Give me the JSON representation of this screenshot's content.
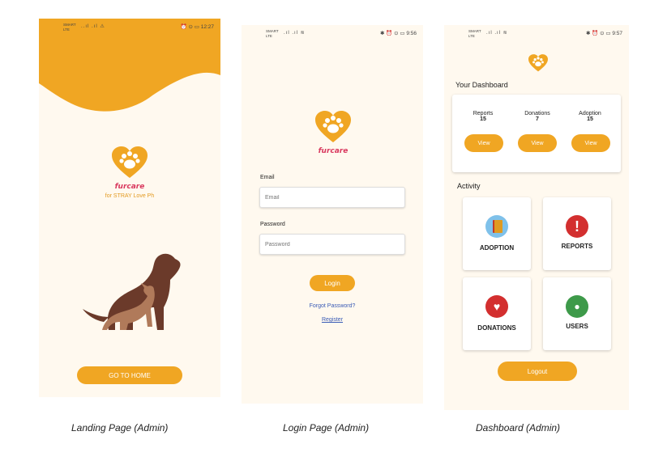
{
  "colors": {
    "accent": "#f0a623",
    "brand": "#d9385e",
    "background": "#fff9ef"
  },
  "landing": {
    "status": {
      "carrier": "SMART LTE",
      "signal": "..ıl .ıl ⚠",
      "right": "⏰ ⊙ ▭ 12:27"
    },
    "brand": "furcare",
    "tagline": "for STRAY Love Ph",
    "button": "GO TO HOME",
    "caption": "Landing Page (Admin)"
  },
  "login": {
    "status": {
      "carrier": "SMART LTE",
      "signal": ".ıl .ıl ≋",
      "right": "✱ ⏰ ⊙ ▭ 9:56"
    },
    "brand": "furcare",
    "email_label": "Email",
    "email_placeholder": "Email",
    "password_label": "Password",
    "password_placeholder": "Password",
    "login_button": "Login",
    "forgot_link": "Forgot Password?",
    "register_link": "Register",
    "caption": "Login Page  (Admin)"
  },
  "dashboard": {
    "status": {
      "carrier": "SMART LTE",
      "signal": ".ıl .ıl ≋",
      "right": "✱ ⏰ ⊙ ▭ 9:57"
    },
    "title": "Your Dashboard",
    "stats": [
      {
        "label": "Reports",
        "value": "15",
        "button": "View"
      },
      {
        "label": "Donations",
        "value": "7",
        "button": "View"
      },
      {
        "label": "Adoption",
        "value": "15",
        "button": "View"
      }
    ],
    "activity_title": "Activity",
    "tiles": [
      {
        "label": "ADOPTION",
        "icon": "adoption-icon",
        "color": "#6ab0e0"
      },
      {
        "label": "REPORTS",
        "icon": "alert-icon",
        "color": "#d32f2f"
      },
      {
        "label": "DONATIONS",
        "icon": "donation-icon",
        "color": "#d32f2f"
      },
      {
        "label": "USERS",
        "icon": "users-icon",
        "color": "#3e9a4a"
      }
    ],
    "logout_button": "Logout",
    "caption": "Dashboard  (Admin)"
  }
}
